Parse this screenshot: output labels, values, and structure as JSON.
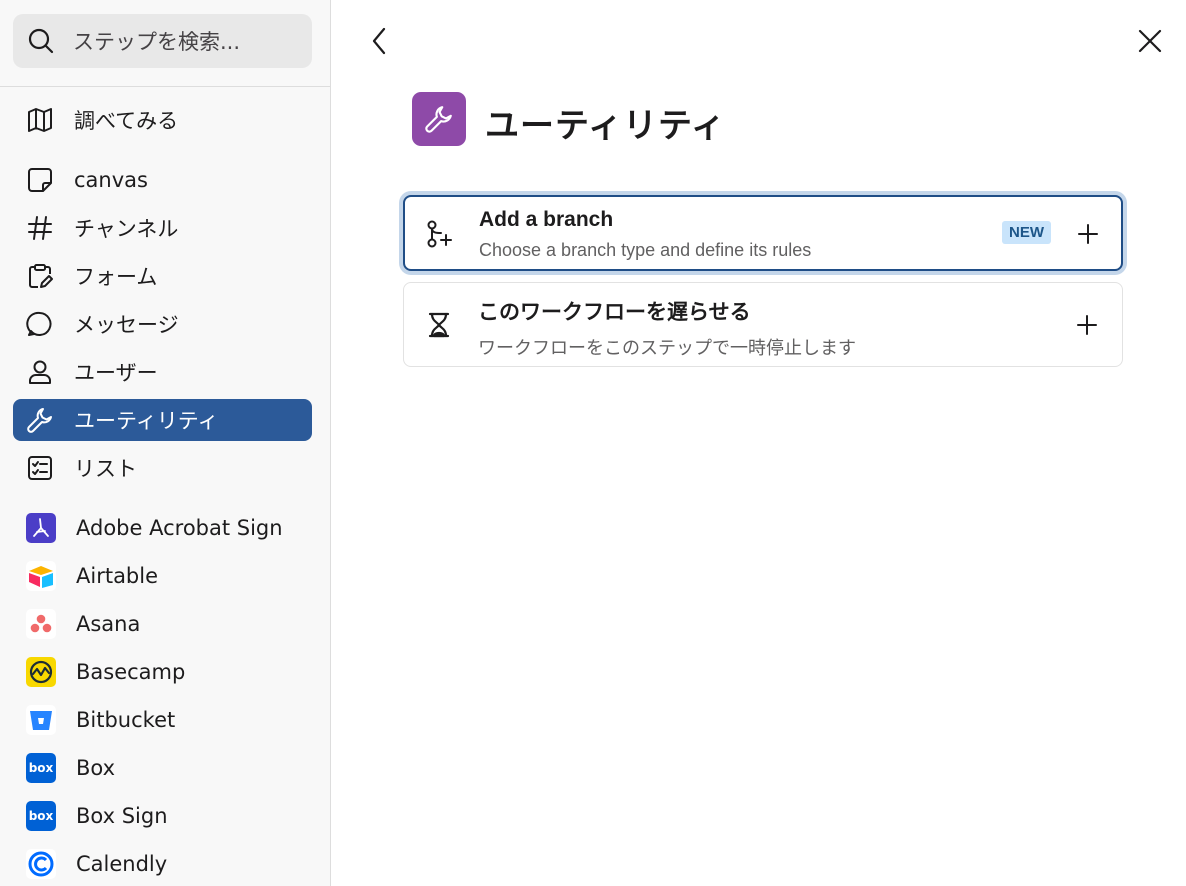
{
  "search": {
    "placeholder": "ステップを検索..."
  },
  "sidebar": {
    "items": [
      {
        "label": "調べてみる",
        "icon": "map-icon"
      },
      {
        "label": "canvas",
        "icon": "canvas-icon"
      },
      {
        "label": "チャンネル",
        "icon": "hash-icon"
      },
      {
        "label": "フォーム",
        "icon": "form-icon"
      },
      {
        "label": "メッセージ",
        "icon": "message-icon"
      },
      {
        "label": "ユーザー",
        "icon": "user-icon"
      },
      {
        "label": "ユーティリティ",
        "icon": "wrench-icon",
        "active": true
      },
      {
        "label": "リスト",
        "icon": "list-icon"
      }
    ],
    "apps": [
      {
        "label": "Adobe Acrobat Sign",
        "icon": "adobe-acrobat-sign-logo"
      },
      {
        "label": "Airtable",
        "icon": "airtable-logo"
      },
      {
        "label": "Asana",
        "icon": "asana-logo"
      },
      {
        "label": "Basecamp",
        "icon": "basecamp-logo"
      },
      {
        "label": "Bitbucket",
        "icon": "bitbucket-logo"
      },
      {
        "label": "Box",
        "icon": "box-logo",
        "logo_text": "box"
      },
      {
        "label": "Box Sign",
        "icon": "box-sign-logo",
        "logo_text": "box"
      },
      {
        "label": "Calendly",
        "icon": "calendly-logo"
      }
    ]
  },
  "main": {
    "title": "ユーティリティ",
    "cards": [
      {
        "title": "Add a branch",
        "subtitle": "Choose a branch type and define its rules",
        "badge": "NEW",
        "icon": "branch-icon"
      },
      {
        "title": "このワークフローを遅らせる",
        "subtitle": "ワークフローをこのステップで一時停止します",
        "icon": "hourglass-icon"
      }
    ]
  },
  "colors": {
    "active_nav": "#2c5a99",
    "utility_purple": "#8e4aa8",
    "badge_bg": "#c9e4fb",
    "badge_text": "#1d5689"
  }
}
